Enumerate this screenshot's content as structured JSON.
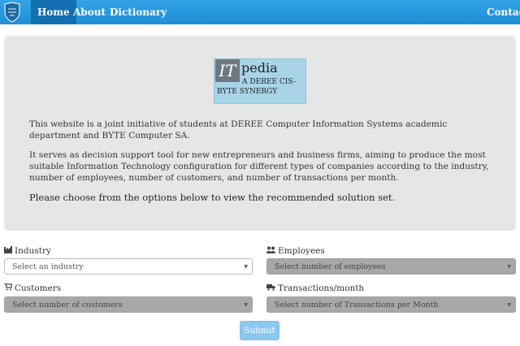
{
  "nav": {
    "items": [
      {
        "label": "Home"
      },
      {
        "label": "About"
      },
      {
        "label": "Dictionary"
      }
    ],
    "contact": "Contact"
  },
  "logo": {
    "it": "IT",
    "pedia": "pedia",
    "sub1": "A DEREE CIS-",
    "sub2": "BYTE SYNERGY"
  },
  "intro": {
    "p1": "This website is a joint initiative of students at DEREE Computer Information Systems academic department and BYTE Computer SA.",
    "p2": "It serves as decision support tool for new entrepreneurs and business firms, aiming to produce the most suitable Information Technology configuration for different types of companies according to the industry, number of employees, number of customers, and number of transactions per month.",
    "p3": "Please choose from the options below to view the recommended solution set."
  },
  "form": {
    "industry": {
      "label": "Industry",
      "icon": "industry-icon",
      "placeholder": "Select an industry",
      "enabled": true
    },
    "employees": {
      "label": "Employees",
      "icon": "users-icon",
      "placeholder": "Select number of employees",
      "enabled": false
    },
    "customers": {
      "label": "Customers",
      "icon": "cart-icon",
      "placeholder": "Select number of customers",
      "enabled": false
    },
    "transactions": {
      "label": "Transactions/month",
      "icon": "truck-icon",
      "placeholder": "Select number of Transactions per Month",
      "enabled": false
    },
    "submit": "Submit"
  },
  "colors": {
    "navbar": "#1f8fd6",
    "nav_active": "#1270b0",
    "jumbotron": "#e6e6e6",
    "logo_bg": "#a9d4e8",
    "disabled_select": "#a8a8a8",
    "submit_bg": "#8cc8ee"
  }
}
